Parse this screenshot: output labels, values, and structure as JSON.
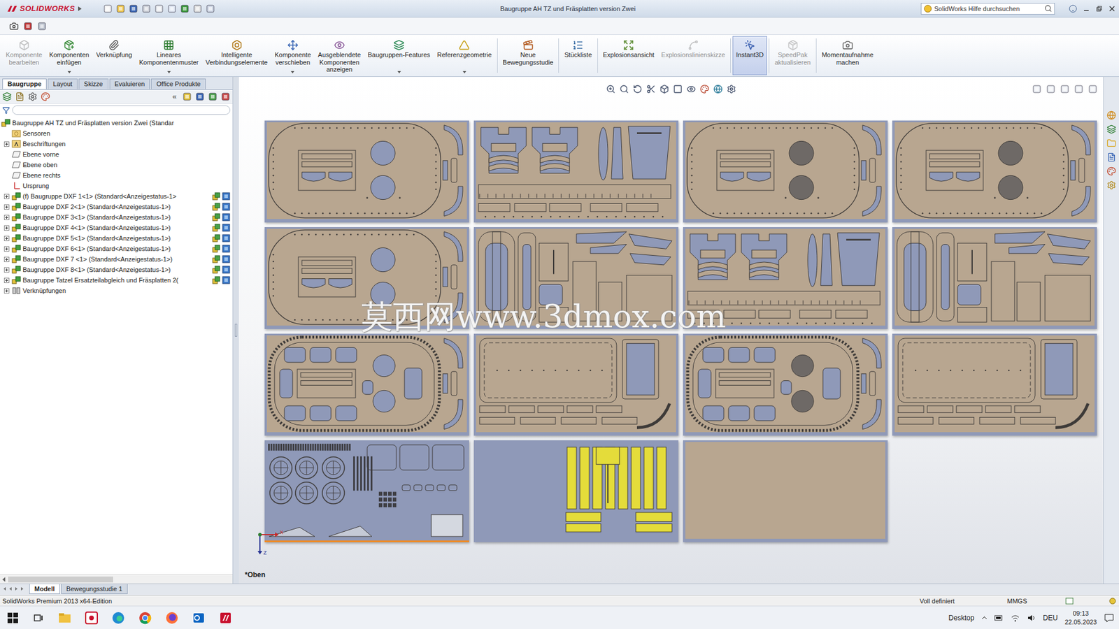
{
  "window": {
    "title": "Baugruppe AH TZ und Fräsplatten version Zwei",
    "logo": "SOLIDWORKS",
    "search_placeholder": "SolidWorks Hilfe durchsuchen"
  },
  "ribbon": [
    {
      "label": "Komponente\nbearbeiten",
      "disabled": true,
      "selected": false,
      "has_dropdown": false,
      "separator_after": false
    },
    {
      "label": "Komponenten\neinfügen",
      "disabled": false,
      "selected": false,
      "has_dropdown": true,
      "separator_after": false
    },
    {
      "label": "Verknüpfung",
      "disabled": false,
      "selected": false,
      "has_dropdown": false,
      "separator_after": false
    },
    {
      "label": "Lineares\nKomponentenmuster",
      "disabled": false,
      "selected": false,
      "has_dropdown": true,
      "separator_after": false
    },
    {
      "label": "Intelligente\nVerbindungselemente",
      "disabled": false,
      "selected": false,
      "has_dropdown": false,
      "separator_after": false
    },
    {
      "label": "Komponente\nverschieben",
      "disabled": false,
      "selected": false,
      "has_dropdown": true,
      "separator_after": false
    },
    {
      "label": "Ausgeblendete\nKomponenten\nanzeigen",
      "disabled": false,
      "selected": false,
      "has_dropdown": false,
      "separator_after": false
    },
    {
      "label": "Baugruppen-Features",
      "disabled": false,
      "selected": false,
      "has_dropdown": true,
      "separator_after": false
    },
    {
      "label": "Referenzgeometrie",
      "disabled": false,
      "selected": false,
      "has_dropdown": true,
      "separator_after": true
    },
    {
      "label": "Neue\nBewegungsstudie",
      "disabled": false,
      "selected": false,
      "has_dropdown": false,
      "separator_after": true
    },
    {
      "label": "Stückliste",
      "disabled": false,
      "selected": false,
      "has_dropdown": false,
      "separator_after": true
    },
    {
      "label": "Explosionsansicht",
      "disabled": false,
      "selected": false,
      "has_dropdown": false,
      "separator_after": false
    },
    {
      "label": "Explosionslinienskizze",
      "disabled": true,
      "selected": false,
      "has_dropdown": false,
      "separator_after": true
    },
    {
      "label": "Instant3D",
      "disabled": false,
      "selected": true,
      "has_dropdown": false,
      "separator_after": true
    },
    {
      "label": "SpeedPak\naktualisieren",
      "disabled": true,
      "selected": false,
      "has_dropdown": false,
      "separator_after": true
    },
    {
      "label": "Momentaufnahme\nmachen",
      "disabled": false,
      "selected": false,
      "has_dropdown": false,
      "separator_after": false
    }
  ],
  "tabs": [
    {
      "label": "Baugruppe",
      "selected": true
    },
    {
      "label": "Layout",
      "selected": false
    },
    {
      "label": "Skizze",
      "selected": false
    },
    {
      "label": "Evaluieren",
      "selected": false
    },
    {
      "label": "Office Produkte",
      "selected": false
    }
  ],
  "tree_toolbar": {
    "collapse": "«"
  },
  "tree": {
    "items": [
      {
        "label": "Baugruppe AH TZ und Fräsplatten version Zwei  (Standar",
        "kind": "root",
        "expandable": false
      },
      {
        "label": "Sensoren",
        "kind": "sensors",
        "expandable": false
      },
      {
        "label": "Beschriftungen",
        "kind": "annotations",
        "expandable": true
      },
      {
        "label": "Ebene vorne",
        "kind": "plane",
        "expandable": false
      },
      {
        "label": "Ebene oben",
        "kind": "plane",
        "expandable": false
      },
      {
        "label": "Ebene rechts",
        "kind": "plane",
        "expandable": false
      },
      {
        "label": "Ursprung",
        "kind": "origin",
        "expandable": false
      },
      {
        "label": "(f) Baugruppe DXF 1<1> (Standard<Anzeigestatus-1>",
        "kind": "assembly",
        "expandable": true
      },
      {
        "label": "Baugruppe DXF 2<1> (Standard<Anzeigestatus-1>)",
        "kind": "assembly",
        "expandable": true
      },
      {
        "label": "Baugruppe DXF 3<1> (Standard<Anzeigestatus-1>)",
        "kind": "assembly",
        "expandable": true
      },
      {
        "label": "Baugruppe DXF 4<1> (Standard<Anzeigestatus-1>)",
        "kind": "assembly",
        "expandable": true
      },
      {
        "label": "Baugruppe DXF 5<1> (Standard<Anzeigestatus-1>)",
        "kind": "assembly",
        "expandable": true
      },
      {
        "label": "Baugruppe DXF 6<1> (Standard<Anzeigestatus-1>)",
        "kind": "assembly",
        "expandable": true
      },
      {
        "label": "Baugruppe DXF 7 <1> (Standard<Anzeigestatus-1>)",
        "kind": "assembly",
        "expandable": true
      },
      {
        "label": "Baugruppe DXF 8<1> (Standard<Anzeigestatus-1>)",
        "kind": "assembly",
        "expandable": true
      },
      {
        "label": "Baugruppe Tatzel Ersatzteilabgleich und Fräsplatten 2(",
        "kind": "assembly",
        "expandable": true
      },
      {
        "label": "Verknüpfungen",
        "kind": "mates",
        "expandable": true
      }
    ]
  },
  "graphics": {
    "sheets": [
      {
        "kind": "plate",
        "dark_holes": false,
        "highlighted": false
      },
      {
        "kind": "frame-parts",
        "dark_holes": false,
        "highlighted": false
      },
      {
        "kind": "plate",
        "dark_holes": true,
        "highlighted": false
      },
      {
        "kind": "plate",
        "dark_holes": true,
        "highlighted": false
      },
      {
        "kind": "plate",
        "dark_holes": false,
        "highlighted": false
      },
      {
        "kind": "mixed-parts",
        "dark_holes": false,
        "highlighted": false
      },
      {
        "kind": "frame-parts",
        "dark_holes": false,
        "highlighted": false
      },
      {
        "kind": "mixed-parts",
        "dark_holes": false,
        "highlighted": false
      },
      {
        "kind": "ring",
        "dark_holes": false,
        "highlighted": false
      },
      {
        "kind": "base",
        "dark_holes": false,
        "highlighted": false
      },
      {
        "kind": "ring",
        "dark_holes": true,
        "highlighted": false
      },
      {
        "kind": "base",
        "dark_holes": false,
        "highlighted": false
      },
      {
        "kind": "small-parts",
        "dark_holes": false,
        "highlighted": true
      },
      {
        "kind": "yellow",
        "dark_holes": false,
        "highlighted": false
      },
      {
        "kind": "blank",
        "dark_holes": false,
        "highlighted": false
      }
    ],
    "view_label": "*Oben",
    "triad": {
      "x": "X",
      "z": "Z"
    },
    "watermark": "莫西网www.3dmox.com"
  },
  "bottom_tabs": [
    {
      "label": "Modell",
      "selected": true
    },
    {
      "label": "Bewegungsstudie 1",
      "selected": false
    }
  ],
  "status_bar": {
    "edition": "SolidWorks Premium 2013 x64-Edition",
    "state": "Voll definiert",
    "units": "MMGS"
  },
  "taskbar": {
    "desktop": "Desktop",
    "language": "DEU",
    "time": "09:13",
    "date": "22.05.2023"
  }
}
